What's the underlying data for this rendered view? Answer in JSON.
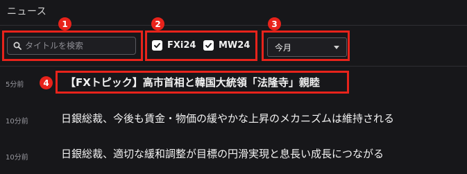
{
  "header": {
    "title": "ニュース"
  },
  "filters": {
    "search": {
      "placeholder": "タイトルを検索",
      "value": ""
    },
    "checkboxes": [
      {
        "label": "FXi24",
        "checked": true
      },
      {
        "label": "MW24",
        "checked": true
      }
    ],
    "period": {
      "selected": "今月"
    }
  },
  "markers": [
    "1",
    "2",
    "3",
    "4"
  ],
  "news": [
    {
      "time": "5分前",
      "title": "【FXトピック】高市首相と韓国大統領「法隆寺」親睦"
    },
    {
      "time": "10分前",
      "title": "日銀総裁、今後も賃金・物価の緩やかな上昇のメカニズムは維持される"
    },
    {
      "time": "10分前",
      "title": "日銀総裁、適切な緩和調整が目標の円滑実現と息長い成長につながる"
    }
  ],
  "colors": {
    "background": "#17171a",
    "highlight": "#e8231b"
  }
}
